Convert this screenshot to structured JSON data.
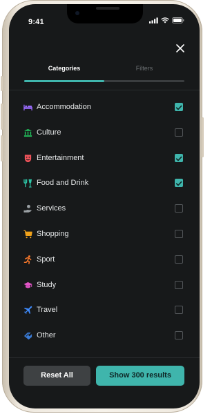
{
  "status_bar": {
    "time": "9:41",
    "icons": [
      "signal-icon",
      "wifi-icon",
      "battery-icon"
    ]
  },
  "tabs": [
    {
      "label": "Categories",
      "active": true
    },
    {
      "label": "Filters",
      "active": false
    }
  ],
  "categories": [
    {
      "label": "Accommodation",
      "icon": "bed-icon",
      "color": "#9b6cff",
      "checked": true
    },
    {
      "label": "Culture",
      "icon": "museum-icon",
      "color": "#22c35d",
      "checked": false
    },
    {
      "label": "Entertainment",
      "icon": "theater-mask-icon",
      "color": "#f2545b",
      "checked": true
    },
    {
      "label": "Food and Drink",
      "icon": "cutlery-glass-icon",
      "color": "#2ec4a6",
      "checked": true
    },
    {
      "label": "Services",
      "icon": "hand-service-icon",
      "color": "#9aa0a4",
      "checked": false
    },
    {
      "label": "Shopping",
      "icon": "shopping-cart-icon",
      "color": "#f0a21c",
      "checked": false
    },
    {
      "label": "Sport",
      "icon": "running-icon",
      "color": "#ff7a2b",
      "checked": false
    },
    {
      "label": "Study",
      "icon": "graduation-cap-icon",
      "color": "#e455c8",
      "checked": false
    },
    {
      "label": "Travel",
      "icon": "airplane-icon",
      "color": "#3f8cff",
      "checked": false
    },
    {
      "label": "Other",
      "icon": "tag-icon",
      "color": "#3a7bd5",
      "checked": false
    }
  ],
  "buttons": {
    "reset": "Reset All",
    "show": "Show 300 results"
  },
  "colors": {
    "accent": "#3fb5ac",
    "background": "#17191a"
  }
}
